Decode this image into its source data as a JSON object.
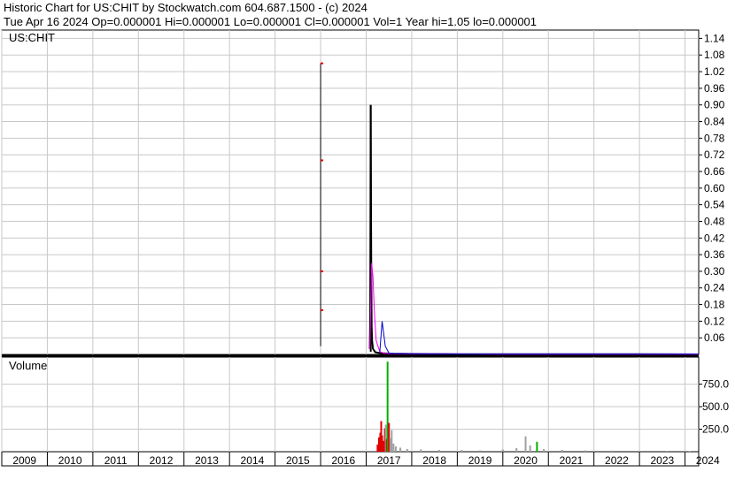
{
  "header": {
    "line1": "Historic Chart for US:CHIT by Stockwatch.com 604.687.1500 - (c) 2024",
    "line2": "Tue Apr 16 2024   Op=0.000001   Hi=0.000001   Lo=0.000001   Cl=0.000001   Vol=1   Year hi=1.05   lo=0.000001"
  },
  "colors": {
    "price_line": "#000000",
    "ma_magenta": "#ff00ff",
    "ma_blue": "#0000cc",
    "vol_red": "#e00000",
    "vol_green": "#00b000",
    "vol_gray": "#a0a0a0",
    "grid": "#c8c8c8"
  },
  "chart_data": [
    {
      "type": "line",
      "title": "US:CHIT",
      "ylim": [
        0,
        1.17
      ],
      "y_ticks": [
        "1.14",
        "1.08",
        "1.02",
        "0.96",
        "0.90",
        "0.84",
        "0.78",
        "0.72",
        "0.66",
        "0.60",
        "0.54",
        "0.48",
        "0.42",
        "0.36",
        "0.30",
        "0.24",
        "0.18",
        "0.12",
        "0.06"
      ],
      "x_ticks": [
        "2009",
        "2010",
        "2011",
        "2012",
        "2013",
        "2014",
        "2015",
        "2016",
        "2017",
        "2018",
        "2019",
        "2020",
        "2021",
        "2022",
        "2023",
        "2024"
      ],
      "grid": true,
      "spikes": [
        {
          "x": 2016.0,
          "low": 0.03,
          "high": 1.05
        },
        {
          "x": 2017.1,
          "low": 0.01,
          "high": 0.9
        }
      ],
      "series": [
        {
          "key": "price",
          "x": [
            2017.08,
            2017.09,
            2017.1,
            2017.11,
            2017.12,
            2017.13,
            2017.15,
            2017.2,
            2017.3,
            2017.4,
            2017.6,
            2018,
            2019,
            2020,
            2021,
            2022,
            2023,
            2024.3
          ],
          "values": [
            0.02,
            0.15,
            0.9,
            0.35,
            0.1,
            0.05,
            0.02,
            0.008,
            0.005,
            0.004,
            0.003,
            0.002,
            0.001,
            0.001,
            0.001,
            0.001,
            0.001,
            1e-06
          ]
        },
        {
          "key": "ma_magenta",
          "x": [
            2017.08,
            2017.12,
            2017.15,
            2017.18,
            2017.22,
            2017.3,
            2017.4,
            2017.6,
            2018,
            2019,
            2020,
            2021,
            2022,
            2023,
            2024.3
          ],
          "values": [
            0.02,
            0.33,
            0.28,
            0.15,
            0.05,
            0.01,
            0.004,
            0.003,
            0.002,
            0.002,
            0.001,
            0.001,
            0.001,
            0.001,
            0.001
          ]
        },
        {
          "key": "ma_blue",
          "x": [
            2017.3,
            2017.35,
            2017.42,
            2017.5,
            2017.6,
            2018,
            2019,
            2020,
            2021,
            2022,
            2023,
            2024.3
          ],
          "values": [
            0.01,
            0.12,
            0.03,
            0.005,
            0.004,
            0.003,
            0.002,
            0.002,
            0.002,
            0.002,
            0.002,
            0.002
          ]
        }
      ]
    },
    {
      "type": "bar",
      "title": "Volume",
      "ylim": [
        0,
        1050
      ],
      "y_ticks": [
        "750.0",
        "500.0",
        "250.0"
      ],
      "bars": [
        {
          "x": 2017.25,
          "v": 80,
          "c": "red"
        },
        {
          "x": 2017.28,
          "v": 160,
          "c": "red"
        },
        {
          "x": 2017.31,
          "v": 210,
          "c": "red"
        },
        {
          "x": 2017.33,
          "v": 340,
          "c": "red"
        },
        {
          "x": 2017.35,
          "v": 180,
          "c": "red"
        },
        {
          "x": 2017.38,
          "v": 120,
          "c": "red"
        },
        {
          "x": 2017.41,
          "v": 260,
          "c": "red"
        },
        {
          "x": 2017.43,
          "v": 300,
          "c": "gray"
        },
        {
          "x": 2017.45,
          "v": 140,
          "c": "red"
        },
        {
          "x": 2017.47,
          "v": 1000,
          "c": "green"
        },
        {
          "x": 2017.5,
          "v": 320,
          "c": "red"
        },
        {
          "x": 2017.53,
          "v": 150,
          "c": "gray"
        },
        {
          "x": 2017.56,
          "v": 240,
          "c": "gray"
        },
        {
          "x": 2017.6,
          "v": 90,
          "c": "gray"
        },
        {
          "x": 2017.65,
          "v": 60,
          "c": "gray"
        },
        {
          "x": 2017.75,
          "v": 45,
          "c": "gray"
        },
        {
          "x": 2017.9,
          "v": 30,
          "c": "gray"
        },
        {
          "x": 2018.2,
          "v": 25,
          "c": "gray"
        },
        {
          "x": 2018.6,
          "v": 20,
          "c": "gray"
        },
        {
          "x": 2019.1,
          "v": 18,
          "c": "gray"
        },
        {
          "x": 2019.5,
          "v": 15,
          "c": "gray"
        },
        {
          "x": 2020.0,
          "v": 25,
          "c": "gray"
        },
        {
          "x": 2020.3,
          "v": 40,
          "c": "gray"
        },
        {
          "x": 2020.5,
          "v": 170,
          "c": "gray"
        },
        {
          "x": 2020.6,
          "v": 70,
          "c": "gray"
        },
        {
          "x": 2020.75,
          "v": 110,
          "c": "green"
        },
        {
          "x": 2020.9,
          "v": 30,
          "c": "gray"
        },
        {
          "x": 2021.3,
          "v": 20,
          "c": "gray"
        },
        {
          "x": 2021.8,
          "v": 15,
          "c": "gray"
        },
        {
          "x": 2022.4,
          "v": 12,
          "c": "gray"
        },
        {
          "x": 2023.0,
          "v": 10,
          "c": "gray"
        },
        {
          "x": 2023.6,
          "v": 10,
          "c": "gray"
        },
        {
          "x": 2024.1,
          "v": 8,
          "c": "gray"
        },
        {
          "x": 2016.0,
          "v": 8,
          "c": "gray"
        }
      ]
    }
  ]
}
